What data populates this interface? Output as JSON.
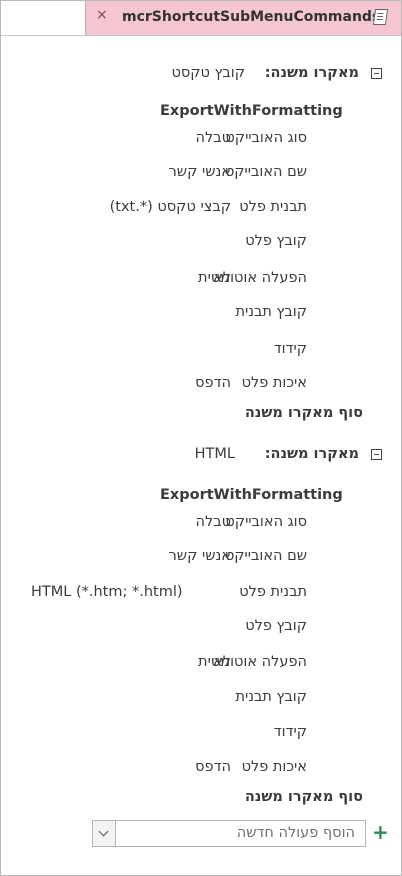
{
  "tab": {
    "title": "mcrShortcutSubMenuCommands",
    "close_symbol": "×"
  },
  "submacro_label": "מאקרו משנה:",
  "submacros": [
    {
      "name": "קובץ טקסט",
      "action": "ExportWithFormatting",
      "args": [
        {
          "label": "סוג האובייקט",
          "value": "טבלה"
        },
        {
          "label": "שם האובייקט",
          "value": "אנשי קשר"
        },
        {
          "label": "תבנית פלט",
          "value": "קבצי טקסט (*.txt)"
        },
        {
          "label": "קובץ פלט",
          "value": ""
        },
        {
          "label": "הפעלה אוטומטית",
          "value": "לא"
        },
        {
          "label": "קובץ תבנית",
          "value": ""
        },
        {
          "label": "קידוד",
          "value": ""
        },
        {
          "label": "איכות פלט",
          "value": "הדפס"
        }
      ],
      "end": "סוף מאקרו משנה"
    },
    {
      "name": "HTML",
      "action": "ExportWithFormatting",
      "args": [
        {
          "label": "סוג האובייקט",
          "value": "טבלה"
        },
        {
          "label": "שם האובייקט",
          "value": "אנשי קשר"
        },
        {
          "label": "תבנית פלט",
          "value": "HTML (*.htm; *.html)"
        },
        {
          "label": "קובץ פלט",
          "value": ""
        },
        {
          "label": "הפעלה אוטומטית",
          "value": "לא"
        },
        {
          "label": "קובץ תבנית",
          "value": ""
        },
        {
          "label": "קידוד",
          "value": ""
        },
        {
          "label": "איכות פלט",
          "value": "הדפס"
        }
      ],
      "end": "סוף מאקרו משנה"
    }
  ],
  "add_action": {
    "placeholder": "הוסף פעולה חדשה",
    "plus_symbol": "+"
  }
}
